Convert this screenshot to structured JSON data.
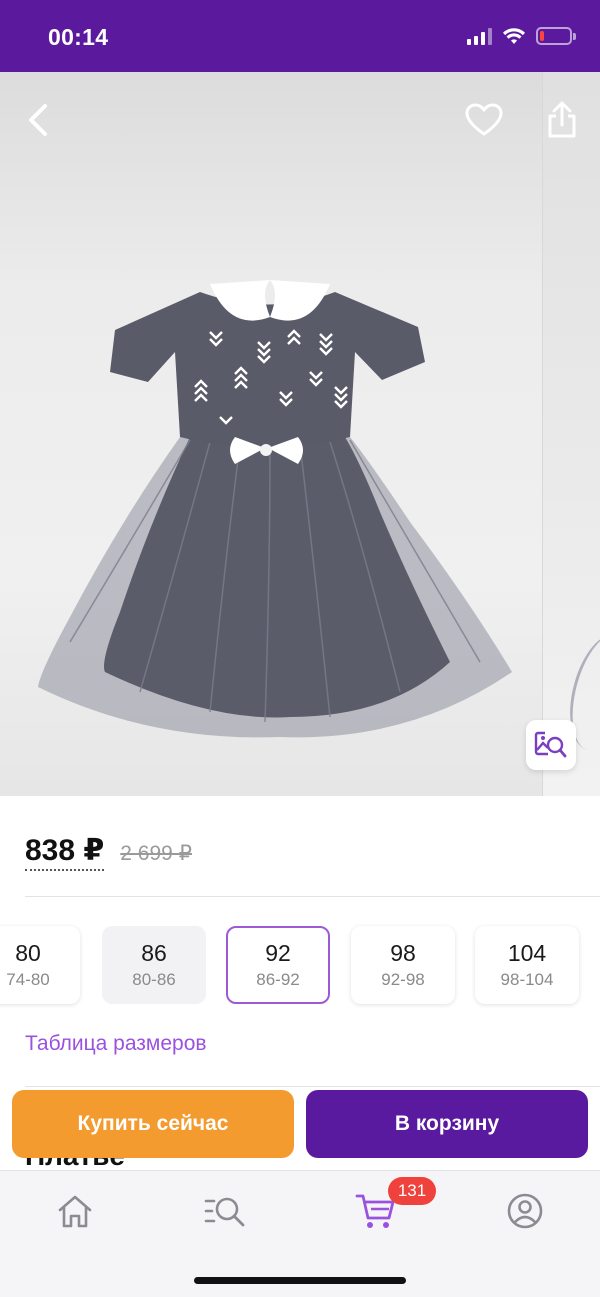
{
  "status_bar": {
    "time": "00:14"
  },
  "gallery": {
    "icons": [
      "back-icon",
      "heart-icon",
      "share-icon",
      "image-search-icon"
    ]
  },
  "price": {
    "current": "838 ₽",
    "old": "2 699 ₽"
  },
  "sizes": [
    {
      "size": "80",
      "range": "74-80",
      "state": "available"
    },
    {
      "size": "86",
      "range": "80-86",
      "state": "unavailable"
    },
    {
      "size": "92",
      "range": "86-92",
      "state": "selected"
    },
    {
      "size": "98",
      "range": "92-98",
      "state": "available"
    },
    {
      "size": "104",
      "range": "98-104",
      "state": "available"
    }
  ],
  "size_table_link": "Таблица размеров",
  "product_title_peek": "Платье",
  "actions": {
    "buy_now": "Купить сейчас",
    "add_to_cart": "В корзину"
  },
  "bottom_nav": {
    "items": [
      "home-icon",
      "catalog-search-icon",
      "cart-icon",
      "profile-icon"
    ],
    "cart_count": "131"
  },
  "colors": {
    "brand_purple": "#5b1a9e",
    "buy_orange": "#f39b2f",
    "link_purple": "#9b51e0",
    "badge_red": "#f0423c"
  }
}
